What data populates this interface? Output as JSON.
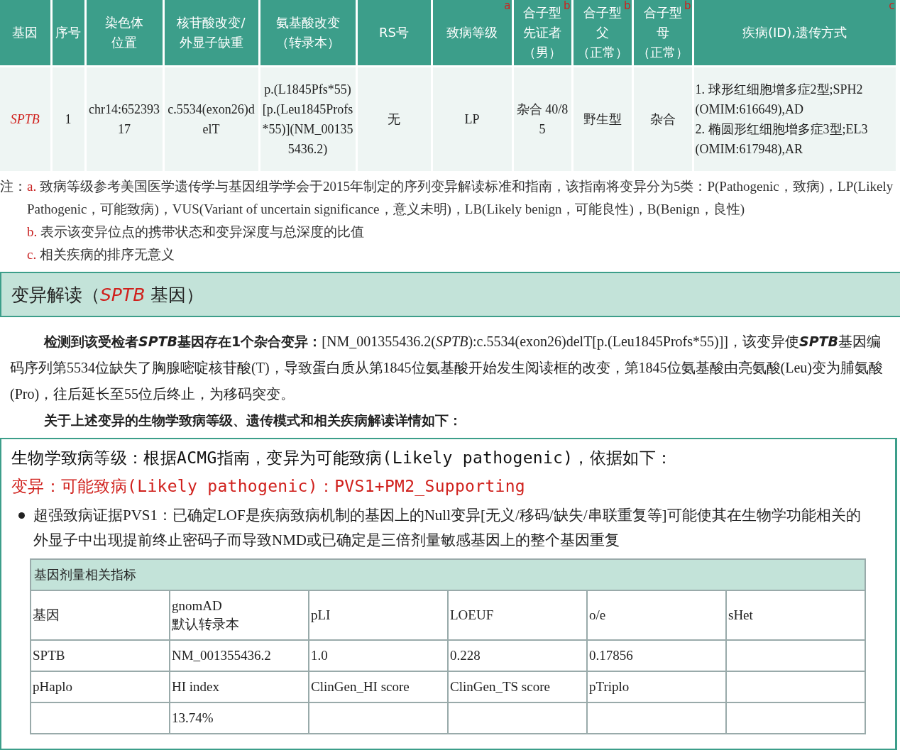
{
  "variant_table": {
    "columns": [
      {
        "lines": [
          "基因"
        ]
      },
      {
        "lines": [
          "序号"
        ]
      },
      {
        "lines": [
          "染色体",
          "位置"
        ]
      },
      {
        "lines": [
          "核苷酸改变/",
          "外显子缺重"
        ]
      },
      {
        "lines": [
          "氨基酸改变",
          "（转录本）"
        ]
      },
      {
        "lines": [
          "RS号"
        ]
      },
      {
        "lines": [
          "致病等级"
        ],
        "note_mark": "a"
      },
      {
        "lines": [
          "合子型",
          "先证者",
          "（男）"
        ],
        "note_mark": "b"
      },
      {
        "lines": [
          "合子型",
          "父",
          "（正常）"
        ],
        "note_mark": "b"
      },
      {
        "lines": [
          "合子型",
          "母",
          "（正常）"
        ],
        "note_mark": "b"
      },
      {
        "lines": [
          "疾病(ID),遗传方式"
        ],
        "note_mark": "c"
      }
    ],
    "rows": [
      {
        "cells": [
          "SPTB",
          "1",
          "chr14:65239317",
          "c.5534(exon26)delT",
          "p.(L1845Pfs*55)[p.(Leu1845Profs*55)](NM_001355436.2)",
          "无",
          "LP",
          "杂合 40/85",
          "野生型",
          "杂合",
          "1. 球形红细胞增多症2型;SPH2 (OMIM:616649),AD\n2. 椭圆形红细胞增多症3型;EL3 (OMIM:617948),AR"
        ]
      }
    ]
  },
  "notes": {
    "prefix": "注：",
    "items": [
      {
        "mark": "a.",
        "text": "致病等级参考美国医学遗传学与基因组学学会于2015年制定的序列变异解读标准和指南，该指南将变异分为5类：P(Pathogenic，致病)，LP(Likely Pathogenic，可能致病)，VUS(Variant of uncertain significance，意义未明)，LB(Likely benign，可能良性)，B(Benign，良性)"
      },
      {
        "mark": "b.",
        "text": "表示该变异位点的携带状态和变异深度与总深度的比值"
      },
      {
        "mark": "c.",
        "text": "相关疾病的排序无意义"
      }
    ]
  },
  "interpretation": {
    "title_before": "变异解读（",
    "gene": "SPTB",
    "title_after": " 基因）",
    "paragraphs": [
      {
        "segments": [
          {
            "text": "检测到该受检者",
            "bold": true,
            "italic": false
          },
          {
            "text": "SPTB",
            "bold": true,
            "italic": true
          },
          {
            "text": "基因存在1个杂合变异：",
            "bold": true,
            "italic": false
          },
          {
            "text": "[NM_001355436.2(",
            "bold": false,
            "italic": false
          },
          {
            "text": "SPTB",
            "bold": false,
            "italic": true
          },
          {
            "text": "):c.5534(exon26)delT[p.(Leu1845Profs*55)]]，该变异使",
            "bold": false,
            "italic": false
          },
          {
            "text": "SPTB",
            "bold": true,
            "italic": true
          },
          {
            "text": "基因编码序列第5534位缺失了胸腺嘧啶核苷酸(T)，导致蛋白质从第1845位氨基酸开始发生阅读框的改变，第1845位氨基酸由亮氨酸(Leu)变为脯氨酸(Pro)，往后延长至55位后终止，为移码突变。",
            "bold": false,
            "italic": false
          }
        ]
      },
      {
        "segments": [
          {
            "text": "关于上述变异的生物学致病等级、遗传模式和相关疾病解读详情如下：",
            "bold": true,
            "italic": false
          }
        ]
      }
    ]
  },
  "evidence": {
    "heading": "生物学致病等级：根据ACMG指南，变异为可能致病(Likely pathogenic)，依据如下：",
    "classification": "变异：可能致病(Likely pathogenic)：PVS1+PM2_Supporting",
    "bullets": [
      "超强致病证据PVS1：已确定LOF是疾病致病机制的基因上的Null变异[无义/移码/缺失/串联重复等]可能使其在生物学功能相关的外显子中出现提前终止密码子而导致NMD或已确定是三倍剂量敏感基因上的整个基因重复"
    ],
    "dosage_table": {
      "title": "基因剂量相关指标",
      "rows": [
        [
          "基因",
          "gnomAD\n默认转录本",
          "pLI",
          "LOEUF",
          "o/e",
          "sHet"
        ],
        [
          "SPTB",
          "NM_001355436.2",
          "1.0",
          "0.228",
          "0.17856",
          null
        ],
        [
          "pHaplo",
          "HI index",
          "ClinGen_HI score",
          "ClinGen_TS score",
          "pTriplo",
          null
        ],
        [
          null,
          "13.74%",
          null,
          null,
          null,
          null
        ]
      ]
    }
  }
}
